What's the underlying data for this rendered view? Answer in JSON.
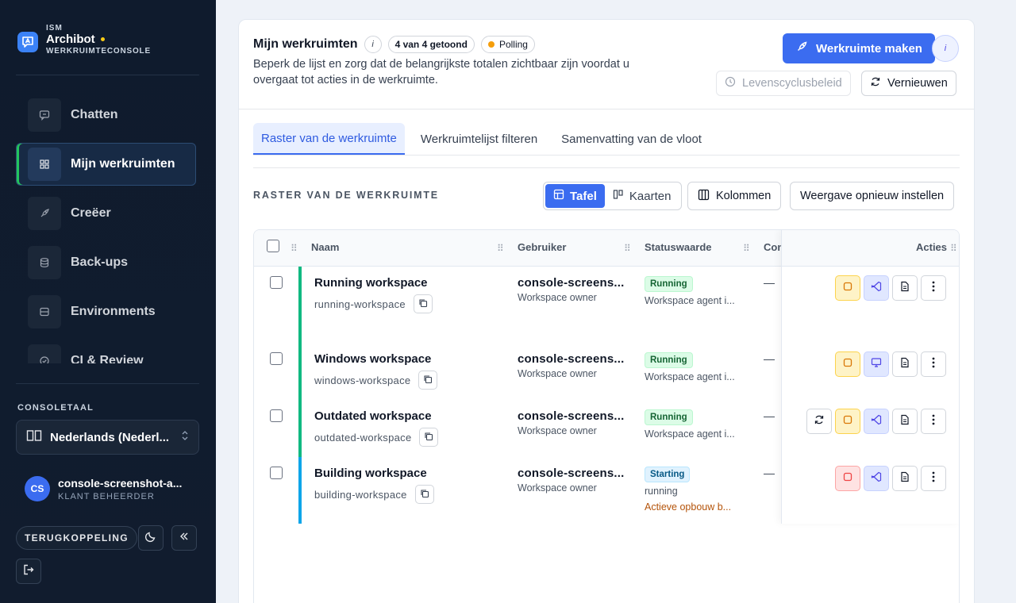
{
  "sidebar": {
    "org": "ISM",
    "app_name": "Archibot",
    "app_sub": "WERKRUIMTECONSOLE",
    "items": [
      {
        "label": "Chatten"
      },
      {
        "label": "Mijn werkruimten"
      },
      {
        "label": "Creëer"
      },
      {
        "label": "Back-ups"
      },
      {
        "label": "Environments"
      },
      {
        "label": "CI & Review"
      }
    ],
    "language_label": "CONSOLETAAL",
    "language_value": "Nederlands (Nederl...",
    "user_initials": "CS",
    "user_name": "console-screenshot-a...",
    "user_role": "KLANT BEHEERDER",
    "feedback_label": "TERUGKOPPELING"
  },
  "header": {
    "title": "Mijn werkruimten",
    "info": "i",
    "count_pill": "4 van 4 getoond",
    "polling_pill": "Polling",
    "description": "Beperk de lijst en zorg dat de belangrijkste totalen zichtbaar zijn voordat u overgaat tot acties in de werkruimte.",
    "create_button": "Werkruimte maken",
    "lifecycle_button": "Levenscyclusbeleid",
    "refresh_button": "Vernieuwen"
  },
  "tabs": [
    {
      "label": "Raster van de werkruimte"
    },
    {
      "label": "Werkruimtelijst filteren"
    },
    {
      "label": "Samenvatting van de vloot"
    }
  ],
  "grid": {
    "section_label": "RASTER VAN DE WERKRUIMTE",
    "view_table": "Tafel",
    "view_cards": "Kaarten",
    "columns_button": "Kolommen",
    "reset_button": "Weergave opnieuw instellen",
    "headers": {
      "name": "Naam",
      "user": "Gebruiker",
      "status": "Statuswaarde",
      "extra": "Con",
      "actions": "Acties"
    },
    "rows": [
      {
        "name": "Running workspace",
        "slug": "running-workspace",
        "user": "console-screens...",
        "role": "Workspace owner",
        "status": "Running",
        "status_desc": "Workspace agent i...",
        "status_desc2": "",
        "col4": "—",
        "bar_color": "#10b981"
      },
      {
        "name": "Windows workspace",
        "slug": "windows-workspace",
        "user": "console-screens...",
        "role": "Workspace owner",
        "status": "Running",
        "status_desc": "Workspace agent i...",
        "status_desc2": "",
        "col4": "—",
        "bar_color": "#10b981"
      },
      {
        "name": "Outdated workspace",
        "slug": "outdated-workspace",
        "user": "console-screens...",
        "role": "Workspace owner",
        "status": "Running",
        "status_desc": "Workspace agent i...",
        "status_desc2": "",
        "col4": "—",
        "bar_color": "#10b981"
      },
      {
        "name": "Building workspace",
        "slug": "building-workspace",
        "user": "console-screens...",
        "role": "Workspace owner",
        "status": "Starting",
        "status_desc": "running",
        "status_desc2": "Actieve opbouw b...",
        "col4": "—",
        "bar_color": "#0ea5e9"
      }
    ]
  },
  "colors": {
    "accent": "#3b6cf0",
    "sidebar_bg": "#0f1b2d",
    "running": "#10b981",
    "starting": "#0ea5e9",
    "polling": "#f59e0b"
  }
}
